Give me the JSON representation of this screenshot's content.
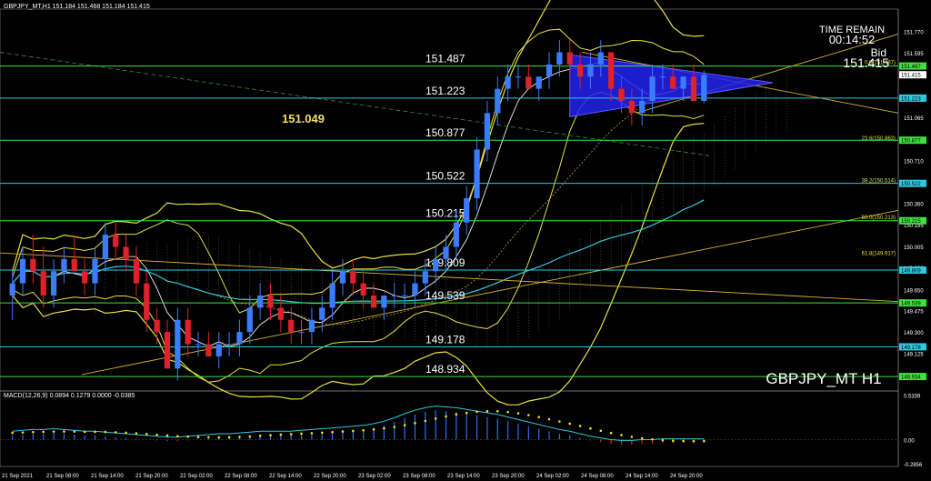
{
  "header": {
    "text": "GBPJPY_MT,H1  151.184 151.468 151.184 151.415"
  },
  "symbol_watermark": "GBPJPY_MT H1",
  "time_remain": {
    "label": "TIME REMAIN",
    "value": "00:14:52"
  },
  "bid": {
    "label": "Bid",
    "value": "151.415"
  },
  "macd_label": "MACD(12,26,9) 0.0894 0.1279 0.0000 -0.0385",
  "colors": {
    "bull": "#3a7bff",
    "bear": "#e0202a",
    "level": "#40e040",
    "band": "#e8e040",
    "cyan": "#30c8e0",
    "triangle": "#2222ee"
  },
  "chart_data": {
    "type": "candlestick",
    "price_range": [
      148.83,
      151.94
    ],
    "price_ticks": [
      "151.770",
      "151.595",
      "151.415",
      "151.240",
      "151.065",
      "150.890",
      "150.710",
      "150.535",
      "150.360",
      "150.185",
      "150.005",
      "149.830",
      "149.650",
      "149.475",
      "149.300",
      "149.125",
      "148.945"
    ],
    "levels": [
      {
        "price": 151.487,
        "label": "151.487",
        "axis_label": "151.487"
      },
      {
        "price": 151.223,
        "label": "151.223",
        "axis_label": "151.223"
      },
      {
        "price": 150.877,
        "label": "150.877",
        "axis_label": "150.877"
      },
      {
        "price": 150.522,
        "label": "150.522",
        "axis_label": "150.522"
      },
      {
        "price": 150.215,
        "label": "150.215",
        "axis_label": "150.215"
      },
      {
        "price": 149.809,
        "label": "149.809",
        "axis_label": "149.809"
      },
      {
        "price": 149.539,
        "label": "149.539",
        "axis_label": "149.539"
      },
      {
        "price": 149.178,
        "label": "149.178",
        "axis_label": "149.178"
      },
      {
        "price": 148.934,
        "label": "148.934",
        "axis_label": "148.934"
      }
    ],
    "fib_labels": [
      {
        "price": 151.487,
        "label": "0.0(151.487)"
      },
      {
        "price": 150.863,
        "label": "23.6(150.863)"
      },
      {
        "price": 150.514,
        "label": "38.2(150.514)"
      },
      {
        "price": 150.213,
        "label": "50.0(150.213)"
      },
      {
        "price": 149.917,
        "label": "61.8(149.917)"
      }
    ],
    "annotation": {
      "price": 151.049,
      "label": "151.049"
    },
    "time_labels": [
      "21 Sep 2021",
      "21 Sep 08:00",
      "21 Sep 14:00",
      "21 Sep 20:00",
      "22 Sep 02:00",
      "22 Sep 08:00",
      "22 Sep 14:00",
      "22 Sep 20:00",
      "23 Sep 02:00",
      "23 Sep 08:00",
      "23 Sep 14:00",
      "23 Sep 20:00",
      "24 Sep 02:00",
      "24 Sep 08:00",
      "24 Sep 14:00",
      "24 Sep 20:00"
    ],
    "macd_ticks": [
      "0.5339",
      "0.00",
      "-0.2856"
    ],
    "macd_range": [
      -0.32,
      0.58
    ],
    "candles": [
      [
        149.6,
        149.8,
        149.4,
        149.7
      ],
      [
        149.7,
        150.0,
        149.6,
        149.9
      ],
      [
        149.9,
        150.1,
        149.7,
        149.8
      ],
      [
        149.8,
        150.0,
        149.5,
        149.6
      ],
      [
        149.6,
        149.9,
        149.5,
        149.8
      ],
      [
        149.8,
        150.0,
        149.7,
        149.9
      ],
      [
        149.9,
        150.1,
        149.8,
        149.8
      ],
      [
        149.8,
        149.9,
        149.6,
        149.7
      ],
      [
        149.7,
        150.0,
        149.6,
        149.9
      ],
      [
        149.9,
        150.2,
        149.8,
        150.1
      ],
      [
        150.1,
        150.2,
        149.9,
        150.0
      ],
      [
        150.0,
        150.1,
        149.8,
        149.9
      ],
      [
        149.9,
        150.0,
        149.6,
        149.7
      ],
      [
        149.7,
        149.8,
        149.3,
        149.4
      ],
      [
        149.4,
        149.5,
        149.2,
        149.3
      ],
      [
        149.3,
        149.4,
        149.0,
        149.0
      ],
      [
        149.0,
        149.5,
        148.9,
        149.4
      ],
      [
        149.4,
        149.5,
        149.1,
        149.2
      ],
      [
        149.2,
        149.3,
        149.1,
        149.2
      ],
      [
        149.2,
        149.3,
        149.1,
        149.1
      ],
      [
        149.1,
        149.3,
        149.0,
        149.2
      ],
      [
        149.2,
        149.3,
        149.1,
        149.2
      ],
      [
        149.2,
        149.4,
        149.1,
        149.3
      ],
      [
        149.3,
        149.6,
        149.2,
        149.5
      ],
      [
        149.5,
        149.7,
        149.4,
        149.6
      ],
      [
        149.6,
        149.7,
        149.4,
        149.5
      ],
      [
        149.5,
        149.6,
        149.3,
        149.4
      ],
      [
        149.4,
        149.5,
        149.2,
        149.3
      ],
      [
        149.3,
        149.4,
        149.2,
        149.3
      ],
      [
        149.3,
        149.5,
        149.2,
        149.4
      ],
      [
        149.4,
        149.6,
        149.3,
        149.5
      ],
      [
        149.5,
        149.8,
        149.4,
        149.7
      ],
      [
        149.7,
        149.9,
        149.6,
        149.8
      ],
      [
        149.8,
        149.9,
        149.6,
        149.7
      ],
      [
        149.7,
        149.8,
        149.5,
        149.6
      ],
      [
        149.6,
        149.7,
        149.5,
        149.5
      ],
      [
        149.5,
        149.6,
        149.4,
        149.6
      ],
      [
        149.6,
        149.7,
        149.5,
        149.6
      ],
      [
        149.6,
        149.7,
        149.5,
        149.6
      ],
      [
        149.6,
        149.8,
        149.5,
        149.7
      ],
      [
        149.7,
        149.9,
        149.6,
        149.8
      ],
      [
        149.8,
        150.0,
        149.7,
        149.9
      ],
      [
        149.9,
        150.1,
        149.8,
        150.0
      ],
      [
        150.0,
        150.3,
        149.9,
        150.2
      ],
      [
        150.2,
        150.5,
        150.1,
        150.4
      ],
      [
        150.4,
        150.9,
        150.3,
        150.8
      ],
      [
        150.8,
        151.2,
        150.7,
        151.1
      ],
      [
        151.1,
        151.4,
        151.0,
        151.3
      ],
      [
        151.3,
        151.5,
        151.2,
        151.4
      ],
      [
        151.4,
        151.5,
        151.3,
        151.4
      ],
      [
        151.4,
        151.5,
        151.3,
        151.3
      ],
      [
        151.3,
        151.4,
        151.2,
        151.4
      ],
      [
        151.4,
        151.6,
        151.3,
        151.5
      ],
      [
        151.5,
        151.7,
        151.4,
        151.6
      ],
      [
        151.6,
        151.7,
        151.4,
        151.5
      ],
      [
        151.5,
        151.6,
        151.3,
        151.4
      ],
      [
        151.4,
        151.6,
        151.3,
        151.5
      ],
      [
        151.5,
        151.7,
        151.4,
        151.6
      ],
      [
        151.6,
        151.6,
        151.2,
        151.3
      ],
      [
        151.3,
        151.4,
        151.1,
        151.2
      ],
      [
        151.2,
        151.3,
        151.0,
        151.1
      ],
      [
        151.1,
        151.3,
        151.0,
        151.2
      ],
      [
        151.2,
        151.5,
        151.1,
        151.4
      ],
      [
        151.4,
        151.5,
        151.3,
        151.4
      ],
      [
        151.4,
        151.5,
        151.3,
        151.3
      ],
      [
        151.3,
        151.4,
        151.2,
        151.4
      ],
      [
        151.4,
        151.5,
        151.2,
        151.2
      ],
      [
        151.2,
        151.45,
        151.18,
        151.415
      ]
    ],
    "macd_hist": [
      0.05,
      0.06,
      0.07,
      0.07,
      0.08,
      0.07,
      0.06,
      0.05,
      0.05,
      0.04,
      0.03,
      0.02,
      0.01,
      0.0,
      -0.01,
      -0.02,
      -0.02,
      -0.01,
      0.0,
      0.01,
      0.02,
      0.02,
      0.03,
      0.04,
      0.05,
      0.05,
      0.05,
      0.05,
      0.06,
      0.07,
      0.08,
      0.09,
      0.1,
      0.11,
      0.12,
      0.14,
      0.17,
      0.21,
      0.26,
      0.3,
      0.33,
      0.35,
      0.34,
      0.33,
      0.31,
      0.29,
      0.27,
      0.25,
      0.22,
      0.19,
      0.16,
      0.13,
      0.1,
      0.07,
      0.05,
      0.02,
      -0.01,
      -0.03,
      -0.05,
      -0.06,
      -0.06,
      -0.05,
      -0.05,
      -0.04,
      -0.04,
      -0.04,
      -0.04,
      -0.04
    ]
  }
}
